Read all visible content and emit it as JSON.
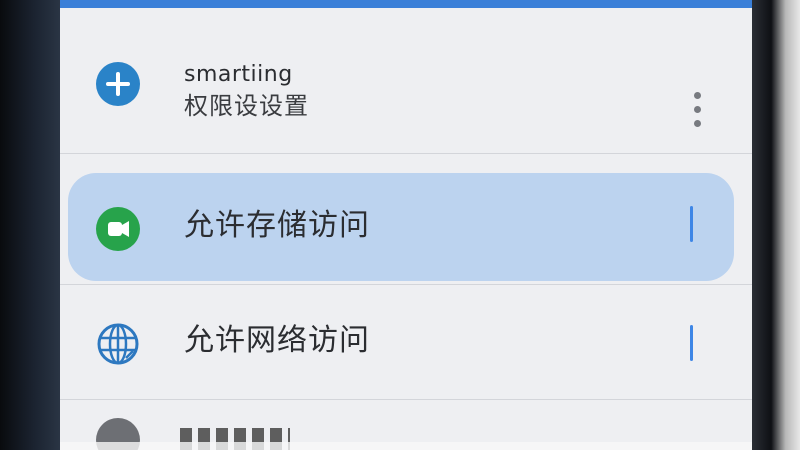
{
  "header": {
    "title": "smartiing",
    "subtitle": "权限设设置",
    "icons": {
      "add": "plus-circle-icon",
      "more": "more-vertical-icon"
    },
    "colors": {
      "add_icon_bg": "#2a83c8",
      "top_bar": "#3a7fd8"
    }
  },
  "items": [
    {
      "label": "允许存储访问",
      "icon": "storage-icon",
      "state": "selected",
      "colors": {
        "icon_bg": "#27a34b",
        "highlight": "#bcd3ef",
        "toggle": "#3e86e6"
      }
    },
    {
      "label": "允许网络访问",
      "icon": "globe-icon",
      "state": "unselected",
      "colors": {
        "icon": "#2d78c0",
        "toggle": "#3e86e6"
      }
    }
  ]
}
